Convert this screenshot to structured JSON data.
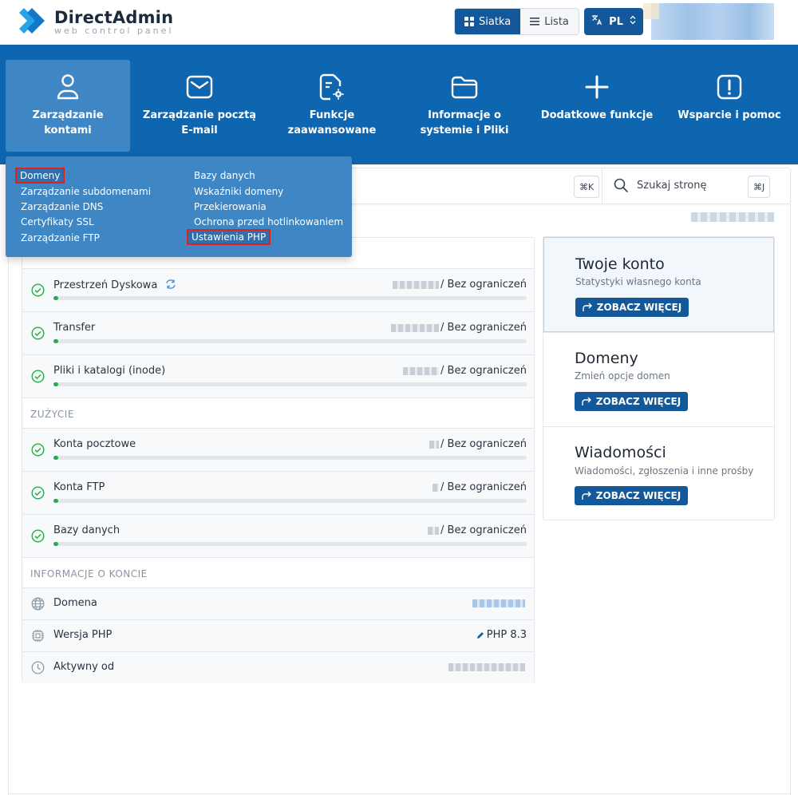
{
  "header": {
    "logo_title": "DirectAdmin",
    "logo_subtitle": "web control panel",
    "view_grid_label": "Siatka",
    "view_list_label": "Lista",
    "language": "PL"
  },
  "nav": [
    {
      "label": "Zarządzanie\nkontami",
      "icon": "user-icon"
    },
    {
      "label": "Zarządzanie pocztą\nE-mail",
      "icon": "mail-icon"
    },
    {
      "label": "Funkcje\nzaawansowane",
      "icon": "file-gear-icon"
    },
    {
      "label": "Informacje o\nsystemie i Pliki",
      "icon": "folder-icon"
    },
    {
      "label": "Dodatkowe funkcje",
      "icon": "plus-icon"
    },
    {
      "label": "Wsparcie i pomoc",
      "icon": "alert-icon"
    }
  ],
  "dropdown": {
    "col1": [
      "Domeny",
      "Zarządzanie subdomenami",
      "Zarządzanie DNS",
      "Certyfikaty SSL",
      "Zarządzanie FTP"
    ],
    "col2": [
      "Bazy danych",
      "Wskaźniki domeny",
      "Przekierowania",
      "Ochrona przed hotlinkowaniem",
      "Ustawienia PHP"
    ]
  },
  "search": {
    "shortcut_left": "⌘K",
    "page_search_label": "Szukaj stronę",
    "shortcut_right": "⌘J"
  },
  "resources": [
    {
      "label": "Przestrzeń Dyskowa",
      "limit": "/ Bez ograniczeń",
      "fill": 0.01
    },
    {
      "label": "Transfer",
      "limit": "/ Bez ograniczeń",
      "fill": 0.01
    },
    {
      "label": "Pliki i katalogi (inode)",
      "limit": "/ Bez ograniczeń",
      "fill": 0.01
    }
  ],
  "usage_header": "ZUŻYCIE",
  "usage": [
    {
      "label": "Konta pocztowe",
      "limit": "/ Bez ograniczeń",
      "fill": 0.01
    },
    {
      "label": "Konta FTP",
      "limit": "/ Bez ograniczeń",
      "fill": 0.01
    },
    {
      "label": "Bazy danych",
      "limit": "/ Bez ograniczeń",
      "fill": 0.01
    }
  ],
  "info_header": "INFORMACJE O KONCIE",
  "info": {
    "domain_label": "Domena",
    "php_label": "Wersja PHP",
    "php_value": "PHP 8.3",
    "active_label": "Aktywny od"
  },
  "cards": [
    {
      "title": "Twoje konto",
      "subtitle": "Statystyki własnego konta",
      "button": "ZOBACZ WIĘCEJ"
    },
    {
      "title": "Domeny",
      "subtitle": "Zmień opcje domen",
      "button": "ZOBACZ WIĘCEJ"
    },
    {
      "title": "Wiadomości",
      "subtitle": "Wiadomości, zgłoszenia i inne prośby",
      "button": "ZOBACZ WIĘCEJ"
    }
  ],
  "colors": {
    "primary": "#12589a",
    "nav_band": "#0e66b0",
    "nav_active": "#3f86c4",
    "success": "#2aa84a",
    "highlight_box": "#e0221d"
  }
}
